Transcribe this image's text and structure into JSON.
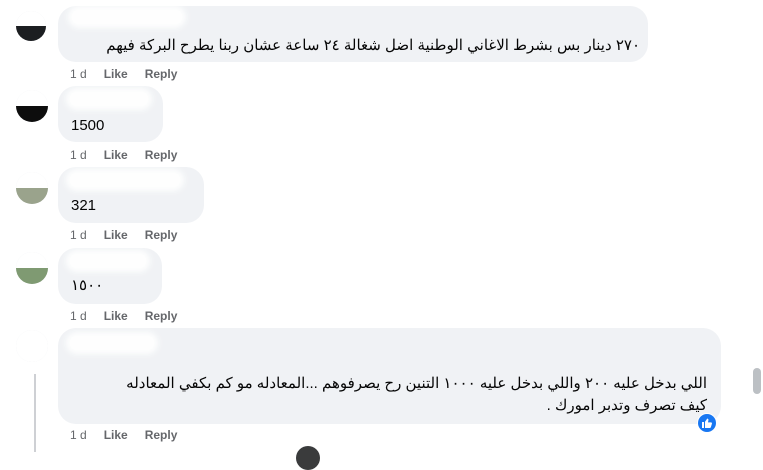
{
  "comments": [
    {
      "text": "٢٧٠ دينار بس بشرط الاغاني الوطنية اضل شغالة ٢٤ ساعة عشان ربنا يطرح البركة فيهم",
      "age": "1 d",
      "like_label": "Like",
      "reply_label": "Reply"
    },
    {
      "text": "1500",
      "age": "1 d",
      "like_label": "Like",
      "reply_label": "Reply"
    },
    {
      "text": "321",
      "age": "1 d",
      "like_label": "Like",
      "reply_label": "Reply"
    },
    {
      "text": "١٥٠٠",
      "age": "1 d",
      "like_label": "Like",
      "reply_label": "Reply"
    },
    {
      "text_line1": "اللي بدخل عليه ٢٠٠ واللي بدخل عليه ١٠٠٠ التنين رح يصرفوهم ...المعادله مو كم بكفي المعادله",
      "text_line2": "كيف تصرف وتدبر امورك .",
      "age": "1 d",
      "like_label": "Like",
      "reply_label": "Reply",
      "reaction_icon": "like-thumb-icon"
    }
  ],
  "colors": {
    "bubble": "#f0f2f5",
    "meta_text": "#65676b",
    "like_reaction": "#1877f2"
  }
}
